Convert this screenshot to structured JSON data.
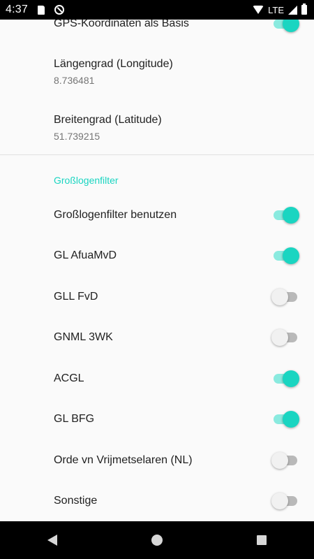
{
  "statusbar": {
    "time": "4:37",
    "network": "LTE"
  },
  "location": {
    "gps_title": "GPS-Koordinaten als Basis",
    "gps_enabled": true,
    "longitude_title": "Längengrad (Longitude)",
    "longitude_value": "8.736481",
    "latitude_title": "Breitengrad (Latitude)",
    "latitude_value": "51.739215"
  },
  "filter": {
    "category": "Großlogenfilter",
    "items": [
      {
        "label": "Großlogenfilter benutzen",
        "enabled": true
      },
      {
        "label": "GL AfuaMvD",
        "enabled": true
      },
      {
        "label": "GLL FvD",
        "enabled": false
      },
      {
        "label": "GNML 3WK",
        "enabled": false
      },
      {
        "label": "ACGL",
        "enabled": true
      },
      {
        "label": "GL BFG",
        "enabled": true
      },
      {
        "label": "Orde vn Vrijmetselaren (NL)",
        "enabled": false
      },
      {
        "label": "Sonstige",
        "enabled": false
      }
    ]
  },
  "colors": {
    "accent": "#1ad5c1",
    "accent_track": "#8aeadf",
    "off_track": "#b9b9b9"
  },
  "icons": {
    "status": [
      "sd-card-icon",
      "do-not-disturb-icon",
      "wifi-icon",
      "signal-icon",
      "battery-icon"
    ],
    "nav": [
      "back-icon",
      "home-icon",
      "recents-icon"
    ]
  }
}
